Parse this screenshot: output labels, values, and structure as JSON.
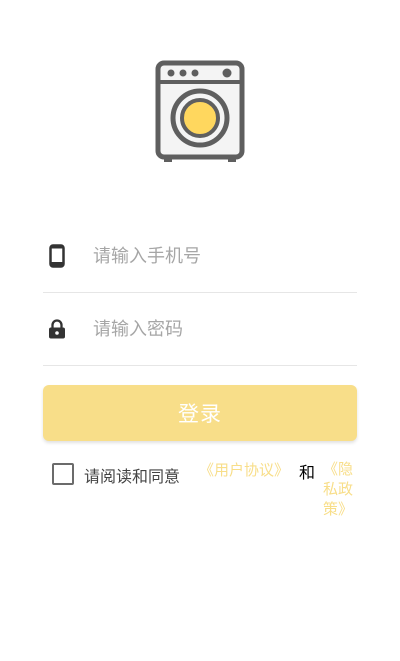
{
  "logo": {
    "icon": "washing-machine-icon",
    "accent": "#ffd75e",
    "color": "#5f5f5f"
  },
  "phone": {
    "icon": "mobile-phone-icon",
    "placeholder": "请输入手机号",
    "value": ""
  },
  "password": {
    "icon": "lock-icon",
    "placeholder": "请输入密码",
    "value": ""
  },
  "login_button": {
    "label": "登录",
    "color": "#f8de89"
  },
  "agreement": {
    "checked": false,
    "text": "请阅读和同意",
    "user_agreement": "《用户协议》",
    "and": "和",
    "privacy_policy": "《隐私政策》",
    "link_color": "#f8de89"
  }
}
